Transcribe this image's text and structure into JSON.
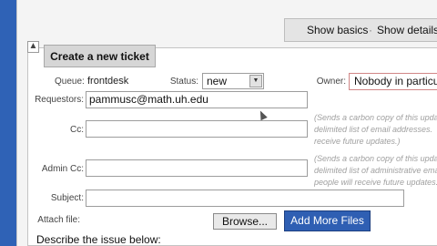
{
  "view_tabs": {
    "basics": "Show basics",
    "separator": "·",
    "details": "Show details"
  },
  "ticket": {
    "heading": "Create a new ticket",
    "queue_label": "Queue:",
    "queue_value": "frontdesk",
    "status_label": "Status:",
    "status_value": "new",
    "owner_label": "Owner:",
    "owner_value": "Nobody in particular",
    "requestors_label": "Requestors:",
    "requestors_value": "pammusc@math.uh.edu",
    "cc_label": "Cc:",
    "admin_cc_label": "Admin Cc:",
    "subject_label": "Subject:",
    "attach_label": "Attach file:",
    "browse_button": "Browse...",
    "add_files_button": "Add More Files",
    "describe_label": "Describe the issue below:"
  },
  "hints": {
    "cc": [
      "(Sends a carbon copy of this update to a comma-",
      "delimited list of email addresses.",
      "receive future updates.)"
    ],
    "admin_cc": [
      "(Sends a carbon copy of this update to a comma-",
      "delimited list of administrative email",
      "people will receive future updates.)"
    ]
  }
}
